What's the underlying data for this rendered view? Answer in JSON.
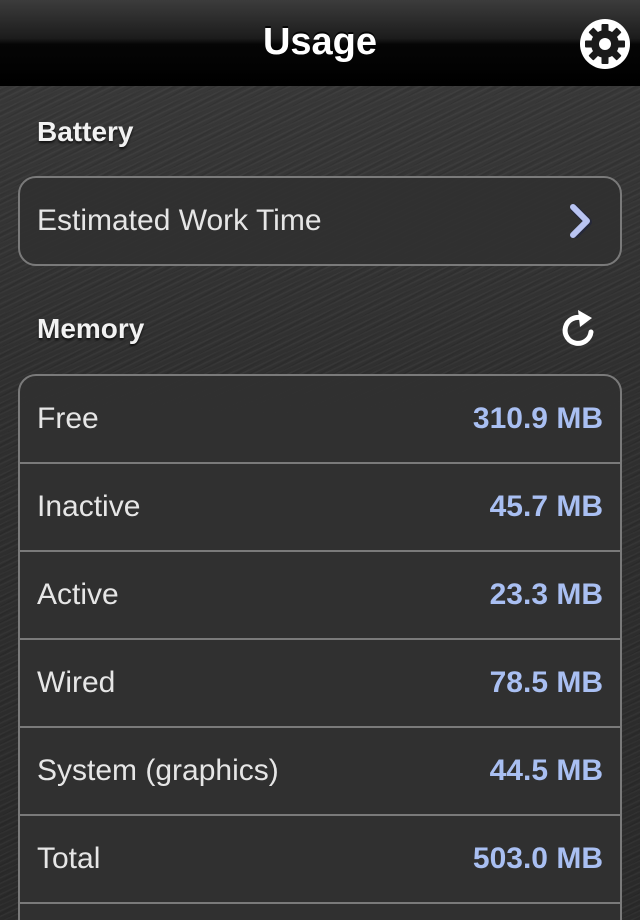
{
  "navbar": {
    "title": "Usage",
    "settings_icon": "gear-icon"
  },
  "battery": {
    "header": "Battery",
    "rows": [
      {
        "label": "Estimated Work Time",
        "icon": "chevron-right-icon"
      }
    ]
  },
  "memory": {
    "header": "Memory",
    "refresh_icon": "refresh-icon",
    "rows": [
      {
        "label": "Free",
        "value": "310.9 MB"
      },
      {
        "label": "Inactive",
        "value": "45.7 MB"
      },
      {
        "label": "Active",
        "value": "23.3 MB"
      },
      {
        "label": "Wired",
        "value": "78.5 MB"
      },
      {
        "label": "System (graphics)",
        "value": "44.5 MB"
      },
      {
        "label": "Total",
        "value": "503.0 MB"
      }
    ]
  },
  "colors": {
    "value_text": "#a9bff2",
    "label_text": "#e6e6e6",
    "header_text": "#f2f2f2",
    "cell_border": "#7a7a7a"
  }
}
